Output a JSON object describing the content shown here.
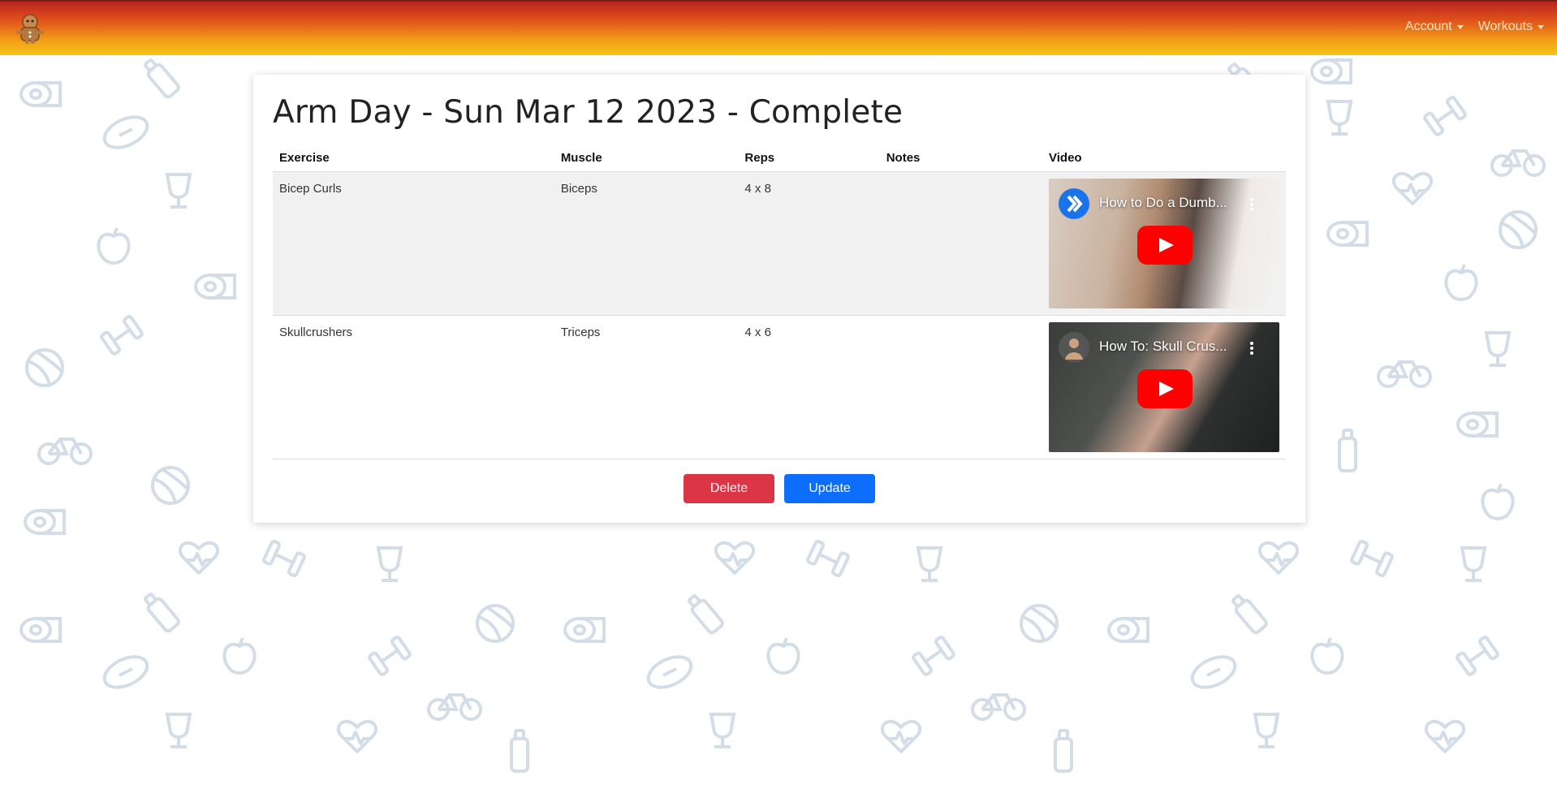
{
  "nav": {
    "logo_icon": "gingerbread-mascot-icon",
    "menus": [
      {
        "label": "Account"
      },
      {
        "label": "Workouts"
      }
    ]
  },
  "workout": {
    "title": "Arm Day - Sun Mar 12 2023 - Complete",
    "columns": [
      "Exercise",
      "Muscle",
      "Reps",
      "Notes",
      "Video"
    ],
    "rows": [
      {
        "exercise": "Bicep Curls",
        "muscle": "Biceps",
        "reps": "4 x 8",
        "notes": "",
        "video_title": "How to Do a Dumb..."
      },
      {
        "exercise": "Skullcrushers",
        "muscle": "Triceps",
        "reps": "4 x 6",
        "notes": "",
        "video_title": "How To: Skull Crus..."
      }
    ]
  },
  "actions": {
    "delete_label": "Delete",
    "update_label": "Update"
  },
  "colors": {
    "delete": "#dc3545",
    "update": "#0d6efd",
    "nav_top": "#b8241f",
    "nav_bottom": "#f5c518",
    "pattern": "#d3dde8"
  }
}
